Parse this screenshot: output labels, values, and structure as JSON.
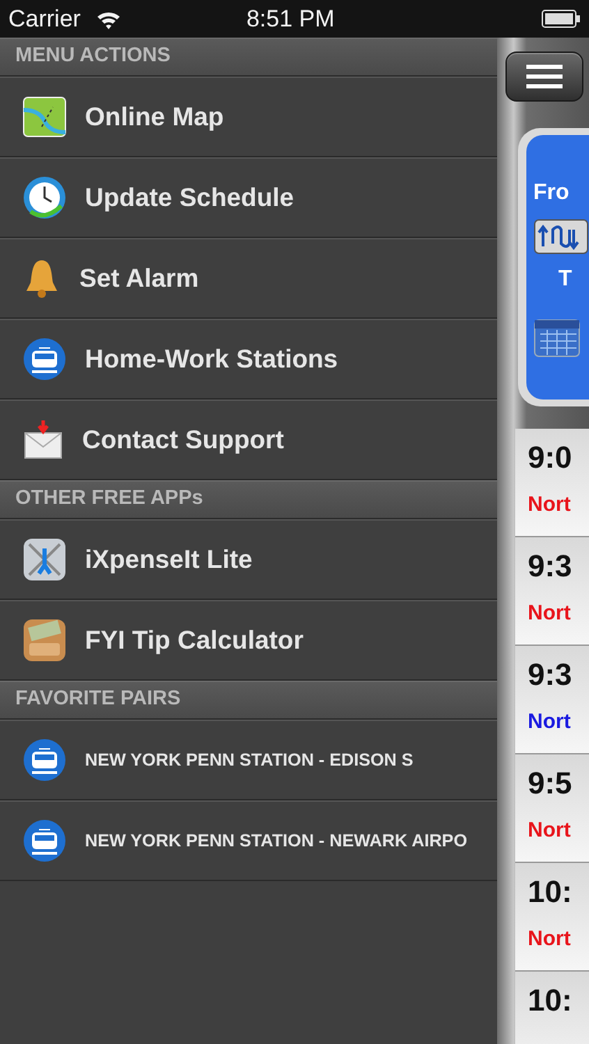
{
  "status_bar": {
    "carrier": "Carrier",
    "time": "8:51 PM"
  },
  "menu": [
    {
      "header": "MENU ACTIONS",
      "items": [
        {
          "label": "Online Map"
        },
        {
          "label": "Update Schedule"
        },
        {
          "label": "Set Alarm"
        },
        {
          "label": "Home-Work Stations"
        },
        {
          "label": "Contact Support"
        }
      ]
    },
    {
      "header": "OTHER FREE APPs",
      "items": [
        {
          "label": "iXpenseIt Lite"
        },
        {
          "label": "FYI Tip Calculator"
        }
      ]
    },
    {
      "header": "FAVORITE PAIRS",
      "small": true,
      "items": [
        {
          "label": "NEW YORK PENN STATION - EDISON S"
        },
        {
          "label": "NEW YORK PENN STATION - NEWARK AIRPO"
        }
      ]
    }
  ],
  "trip_card": {
    "from_label": "Fro",
    "to_label": "T"
  },
  "schedule": [
    {
      "time": "9:0",
      "line": "Nort",
      "color": "#e8141b"
    },
    {
      "time": "9:3",
      "line": "Nort",
      "color": "#e8141b"
    },
    {
      "time": "9:3",
      "line": "Nort",
      "color": "#1a1ae0"
    },
    {
      "time": "9:5",
      "line": "Nort",
      "color": "#e8141b"
    },
    {
      "time": "10:",
      "line": "Nort",
      "color": "#e8141b"
    },
    {
      "time": "10:"
    }
  ]
}
